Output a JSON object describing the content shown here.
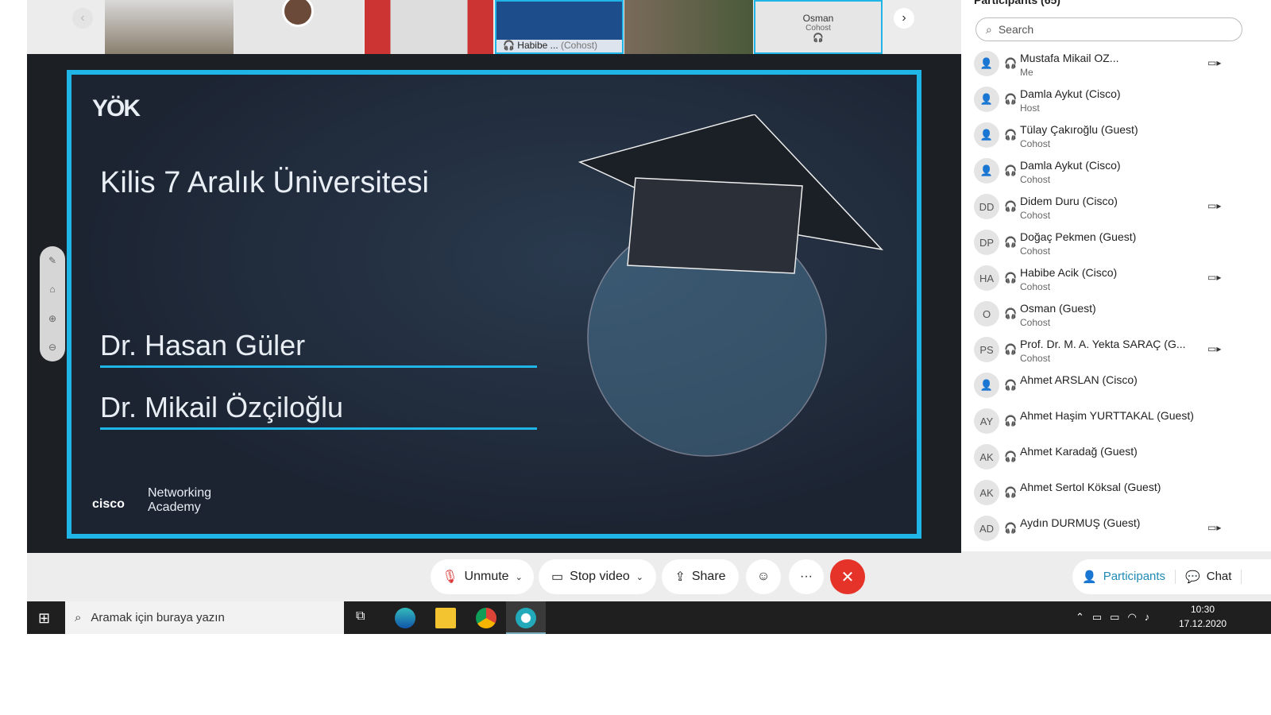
{
  "strip": {
    "tiles": [
      {
        "label": "Habibe ...",
        "role": "(Cohost)"
      },
      {
        "label": "Osman",
        "role": "Cohost"
      }
    ]
  },
  "slide": {
    "title": "Kilis 7 Aralık Üniversitesi",
    "name1": "Dr. Hasan Güler",
    "name2": "Dr. Mikail Özçiloğlu",
    "logo": "YÖK",
    "academy1": "Networking",
    "academy2": "Academy",
    "brand": "cisco"
  },
  "panel": {
    "header": "Participants (65)",
    "search_placeholder": "Search",
    "participants": [
      {
        "initials": "",
        "name": "Mustafa Mikail OZ...",
        "role": "Me",
        "video": true
      },
      {
        "initials": "",
        "name": "Damla Aykut (Cisco)",
        "role": "Host",
        "video": false
      },
      {
        "initials": "",
        "name": "Tülay Çakıroğlu (Guest)",
        "role": "Cohost",
        "video": false
      },
      {
        "initials": "",
        "name": "Damla Aykut (Cisco)",
        "role": "Cohost",
        "video": false
      },
      {
        "initials": "DD",
        "name": "Didem Duru (Cisco)",
        "role": "Cohost",
        "video": true
      },
      {
        "initials": "DP",
        "name": "Doğaç Pekmen (Guest)",
        "role": "Cohost",
        "video": false
      },
      {
        "initials": "HA",
        "name": "Habibe Acik (Cisco)",
        "role": "Cohost",
        "video": true
      },
      {
        "initials": "O",
        "name": "Osman (Guest)",
        "role": "Cohost",
        "video": false
      },
      {
        "initials": "PS",
        "name": "Prof. Dr. M. A. Yekta SARAÇ (G...",
        "role": "Cohost",
        "video": true
      },
      {
        "initials": "",
        "name": "Ahmet ARSLAN (Cisco)",
        "role": "",
        "video": false
      },
      {
        "initials": "AY",
        "name": "Ahmet Haşim YURTTAKAL (Guest)",
        "role": "",
        "video": false
      },
      {
        "initials": "AK",
        "name": "Ahmet Karadağ (Guest)",
        "role": "",
        "video": false
      },
      {
        "initials": "AK",
        "name": "Ahmet Sertol Köksal (Guest)",
        "role": "",
        "video": false
      },
      {
        "initials": "AD",
        "name": "Aydın DURMUŞ (Guest)",
        "role": "",
        "video": true
      }
    ]
  },
  "toolbar": {
    "unmute": "Unmute",
    "stop_video": "Stop video",
    "share": "Share",
    "participants": "Participants",
    "chat": "Chat",
    "more": "···"
  },
  "taskbar": {
    "search_placeholder": "Aramak için buraya yazın",
    "time": "10:30",
    "date": "17.12.2020"
  },
  "colors": {
    "accent": "#1fb5e6",
    "end": "#e5332a"
  }
}
